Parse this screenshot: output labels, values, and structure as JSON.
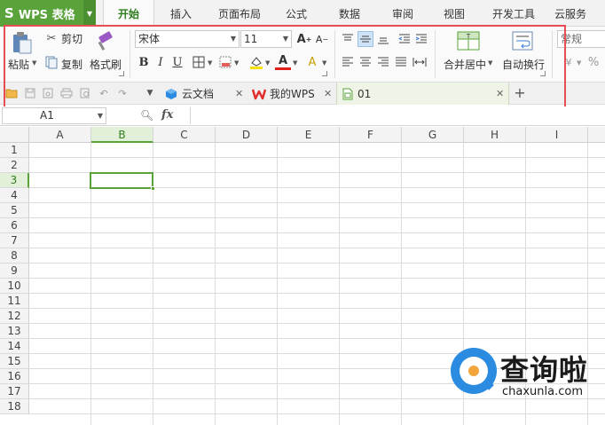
{
  "app": {
    "name": "WPS 表格",
    "logo": "S"
  },
  "menu_tabs": [
    "开始",
    "插入",
    "页面布局",
    "公式",
    "数据",
    "审阅",
    "视图",
    "开发工具",
    "云服务"
  ],
  "active_menu_tab": "开始",
  "ribbon": {
    "paste_label": "粘贴",
    "cut_label": "剪切",
    "copy_label": "复制",
    "format_painter_label": "格式刷",
    "font_name": "宋体",
    "font_size": "11",
    "merge_center_label": "合并居中",
    "wrap_text_label": "自动换行",
    "number_format": "常规",
    "percent_symbol": "%"
  },
  "doc_tabs": [
    {
      "label": "云文档",
      "active": false
    },
    {
      "label": "我的WPS",
      "active": false
    },
    {
      "label": "01",
      "active": true
    }
  ],
  "formula_bar": {
    "cell_ref": "A1",
    "fx_label": "fx"
  },
  "columns": [
    "A",
    "B",
    "C",
    "D",
    "E",
    "F",
    "G",
    "H",
    "I"
  ],
  "rows": [
    "1",
    "2",
    "3",
    "4",
    "5",
    "6",
    "7",
    "8",
    "9",
    "10",
    "11",
    "12",
    "13",
    "14",
    "15",
    "16",
    "17",
    "18"
  ],
  "active_column": "B",
  "active_row": "3",
  "watermark": {
    "cn": "查询啦",
    "en": "chaxunla.com"
  },
  "colors": {
    "brand_green": "#5aa33a",
    "highlight_red": "#e84c57",
    "watermark_blue": "#2a8be0"
  }
}
